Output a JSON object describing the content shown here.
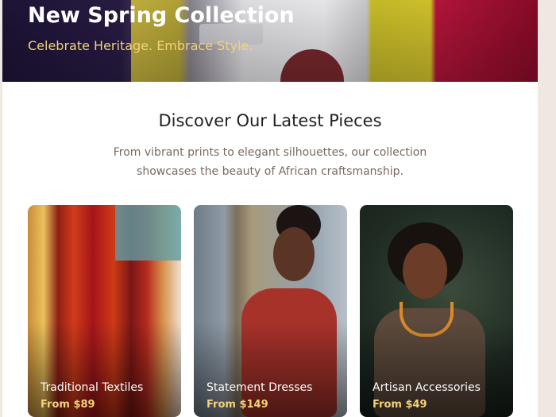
{
  "hero": {
    "title": "New Spring Collection",
    "subtitle": "Celebrate Heritage. Embrace Style."
  },
  "section": {
    "title": "Discover Our Latest Pieces",
    "description": "From vibrant prints to elegant silhouettes, our collection showcases the beauty of African craftsmanship."
  },
  "categories": [
    {
      "label": "Traditional Textiles",
      "price": "From $89"
    },
    {
      "label": "Statement Dresses",
      "price": "From $149"
    },
    {
      "label": "Artisan Accessories",
      "price": "From $49"
    }
  ],
  "colors": {
    "accent": "#f2d27a",
    "page_background": "#efe7e1"
  }
}
